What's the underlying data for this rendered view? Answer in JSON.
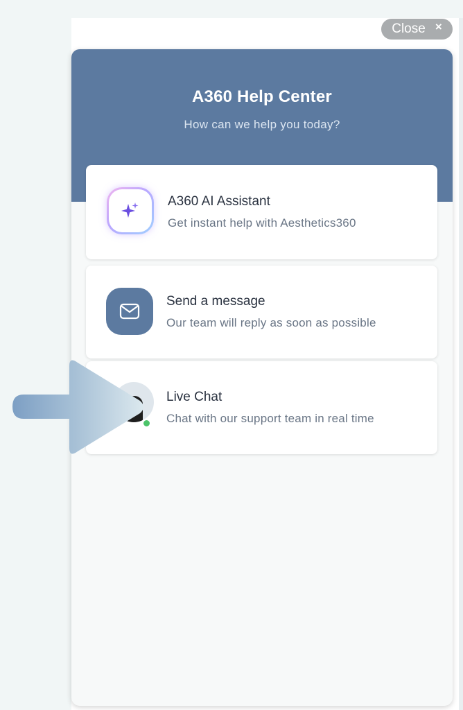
{
  "close_button": {
    "label": "Close",
    "icon": "close-icon",
    "glyph": "×"
  },
  "header": {
    "title": "A360 Help Center",
    "subtitle": "How can we help you today?"
  },
  "options": [
    {
      "title": "A360 AI Assistant",
      "description": "Get instant help with Aesthetics360",
      "icon": "sparkle-icon"
    },
    {
      "title": "Send a message",
      "description": "Our team will reply as soon as possible",
      "icon": "envelope-icon"
    },
    {
      "title": "Live Chat",
      "description": "Chat with our support team in real time",
      "icon": "agent-avatar",
      "status": "online"
    }
  ],
  "colors": {
    "header_bg": "#5c7aa0",
    "accent_purple": "#6b4fe0",
    "online": "#4cc46a",
    "close_pill": "#a9acae"
  }
}
